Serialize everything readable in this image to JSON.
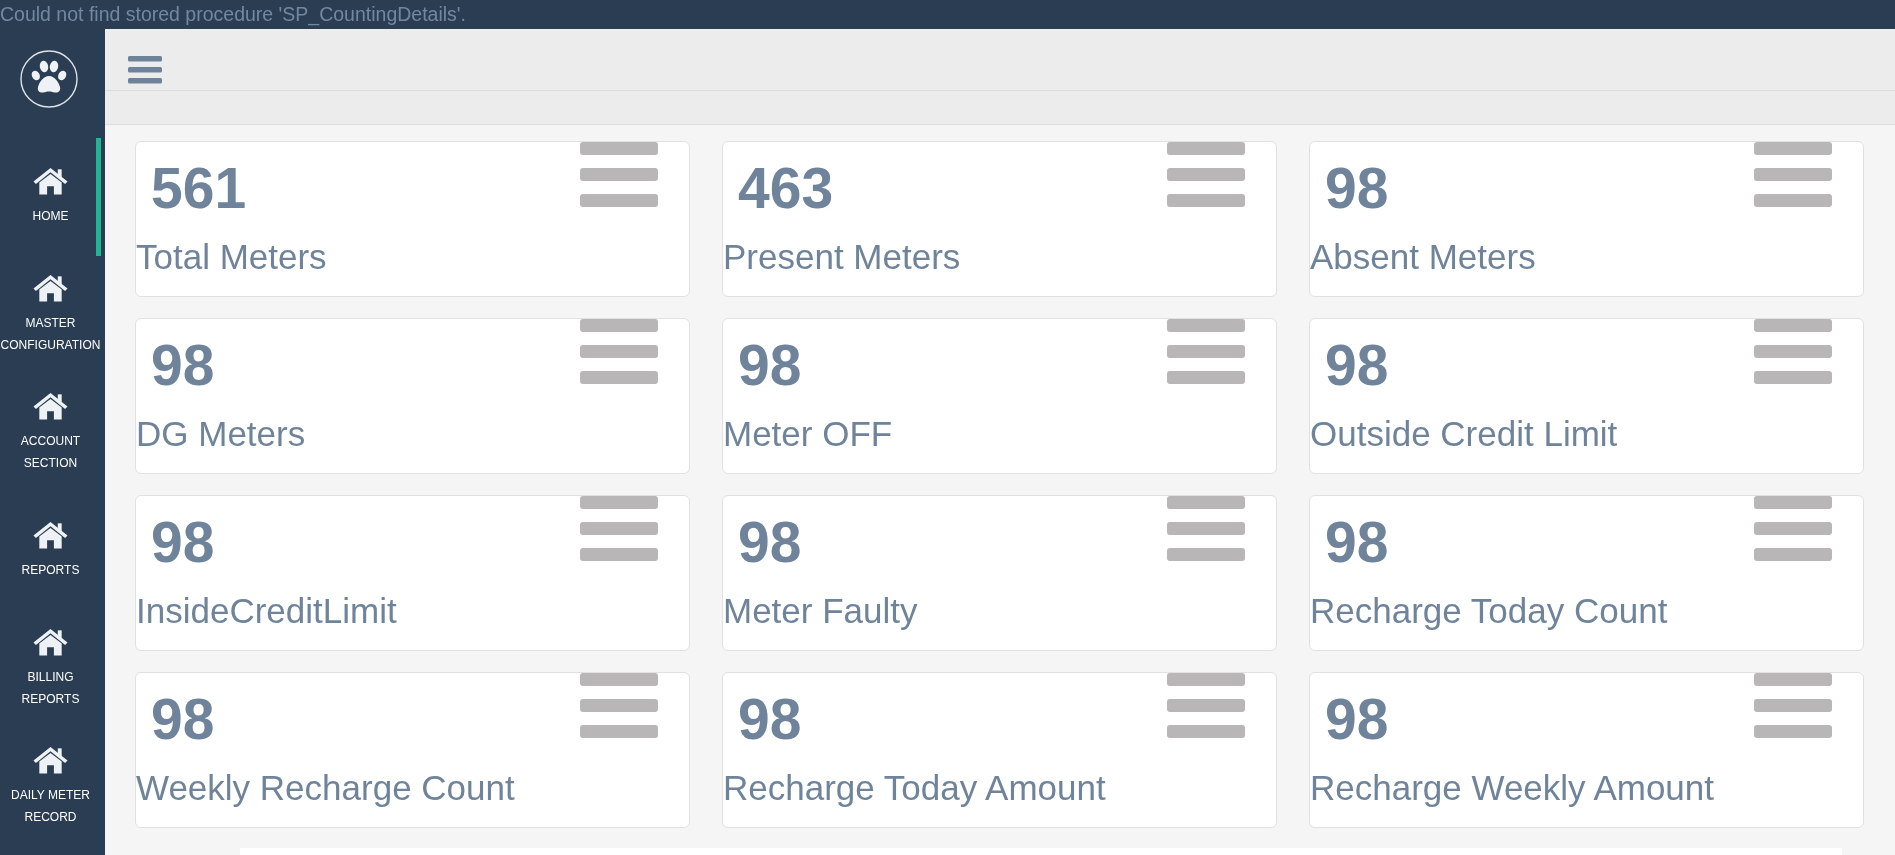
{
  "error_message": "Could not find stored procedure 'SP_CountingDetails'.",
  "sidebar": {
    "items": [
      {
        "label": "HOME",
        "selected": true
      },
      {
        "label": "MASTER CONFIGURATION",
        "selected": false
      },
      {
        "label": "ACCOUNT SECTION",
        "selected": false
      },
      {
        "label": "REPORTS",
        "selected": false
      },
      {
        "label": "BILLING REPORTS",
        "selected": false
      },
      {
        "label": "DAILY METER RECORD",
        "selected": false
      }
    ]
  },
  "cards": [
    {
      "value": "561",
      "label": "Total Meters"
    },
    {
      "value": "463",
      "label": "Present Meters"
    },
    {
      "value": "98",
      "label": "Absent Meters"
    },
    {
      "value": "98",
      "label": "DG Meters"
    },
    {
      "value": "98",
      "label": "Meter OFF"
    },
    {
      "value": "98",
      "label": "Outside Credit Limit"
    },
    {
      "value": "98",
      "label": "InsideCreditLimit"
    },
    {
      "value": "98",
      "label": "Meter Faulty"
    },
    {
      "value": "98",
      "label": "Recharge Today Count"
    },
    {
      "value": "98",
      "label": "Weekly Recharge Count"
    },
    {
      "value": "98",
      "label": "Recharge Today Amount"
    },
    {
      "value": "98",
      "label": "Recharge Weekly Amount"
    }
  ]
}
